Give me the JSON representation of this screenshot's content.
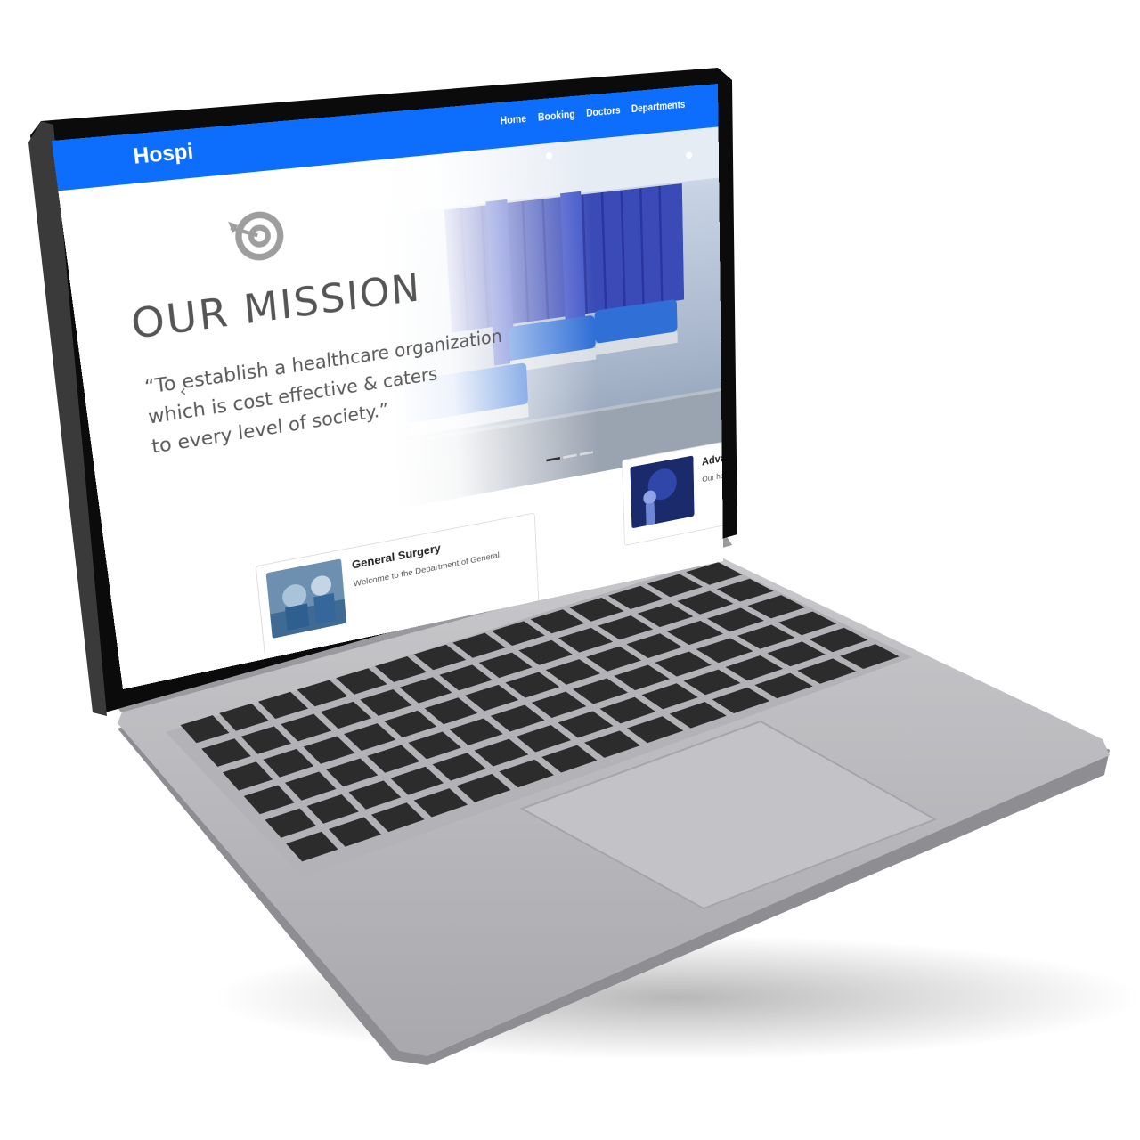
{
  "site": {
    "brand": "Hospi",
    "nav": [
      {
        "label": "Home"
      },
      {
        "label": "Booking"
      },
      {
        "label": "Doctors"
      },
      {
        "label": "Departments"
      }
    ]
  },
  "hero": {
    "title": "OUR  MISSION",
    "quote_lines": [
      "“To establish a healthcare organization",
      "which is cost effective & caters",
      "to every level of society.”"
    ],
    "prev_arrow": "‹",
    "indicators": 3,
    "active_indicator": 0
  },
  "cards": [
    {
      "title": "General Surgery",
      "text": "Welcome to the Department of General"
    },
    {
      "title": "Advanc",
      "text": "Our hosp"
    }
  ],
  "colors": {
    "navbar": "#0d6efd",
    "laptop_body": "#bcbcbf",
    "keys": "#2c2c2c",
    "bezel": "#000000"
  }
}
